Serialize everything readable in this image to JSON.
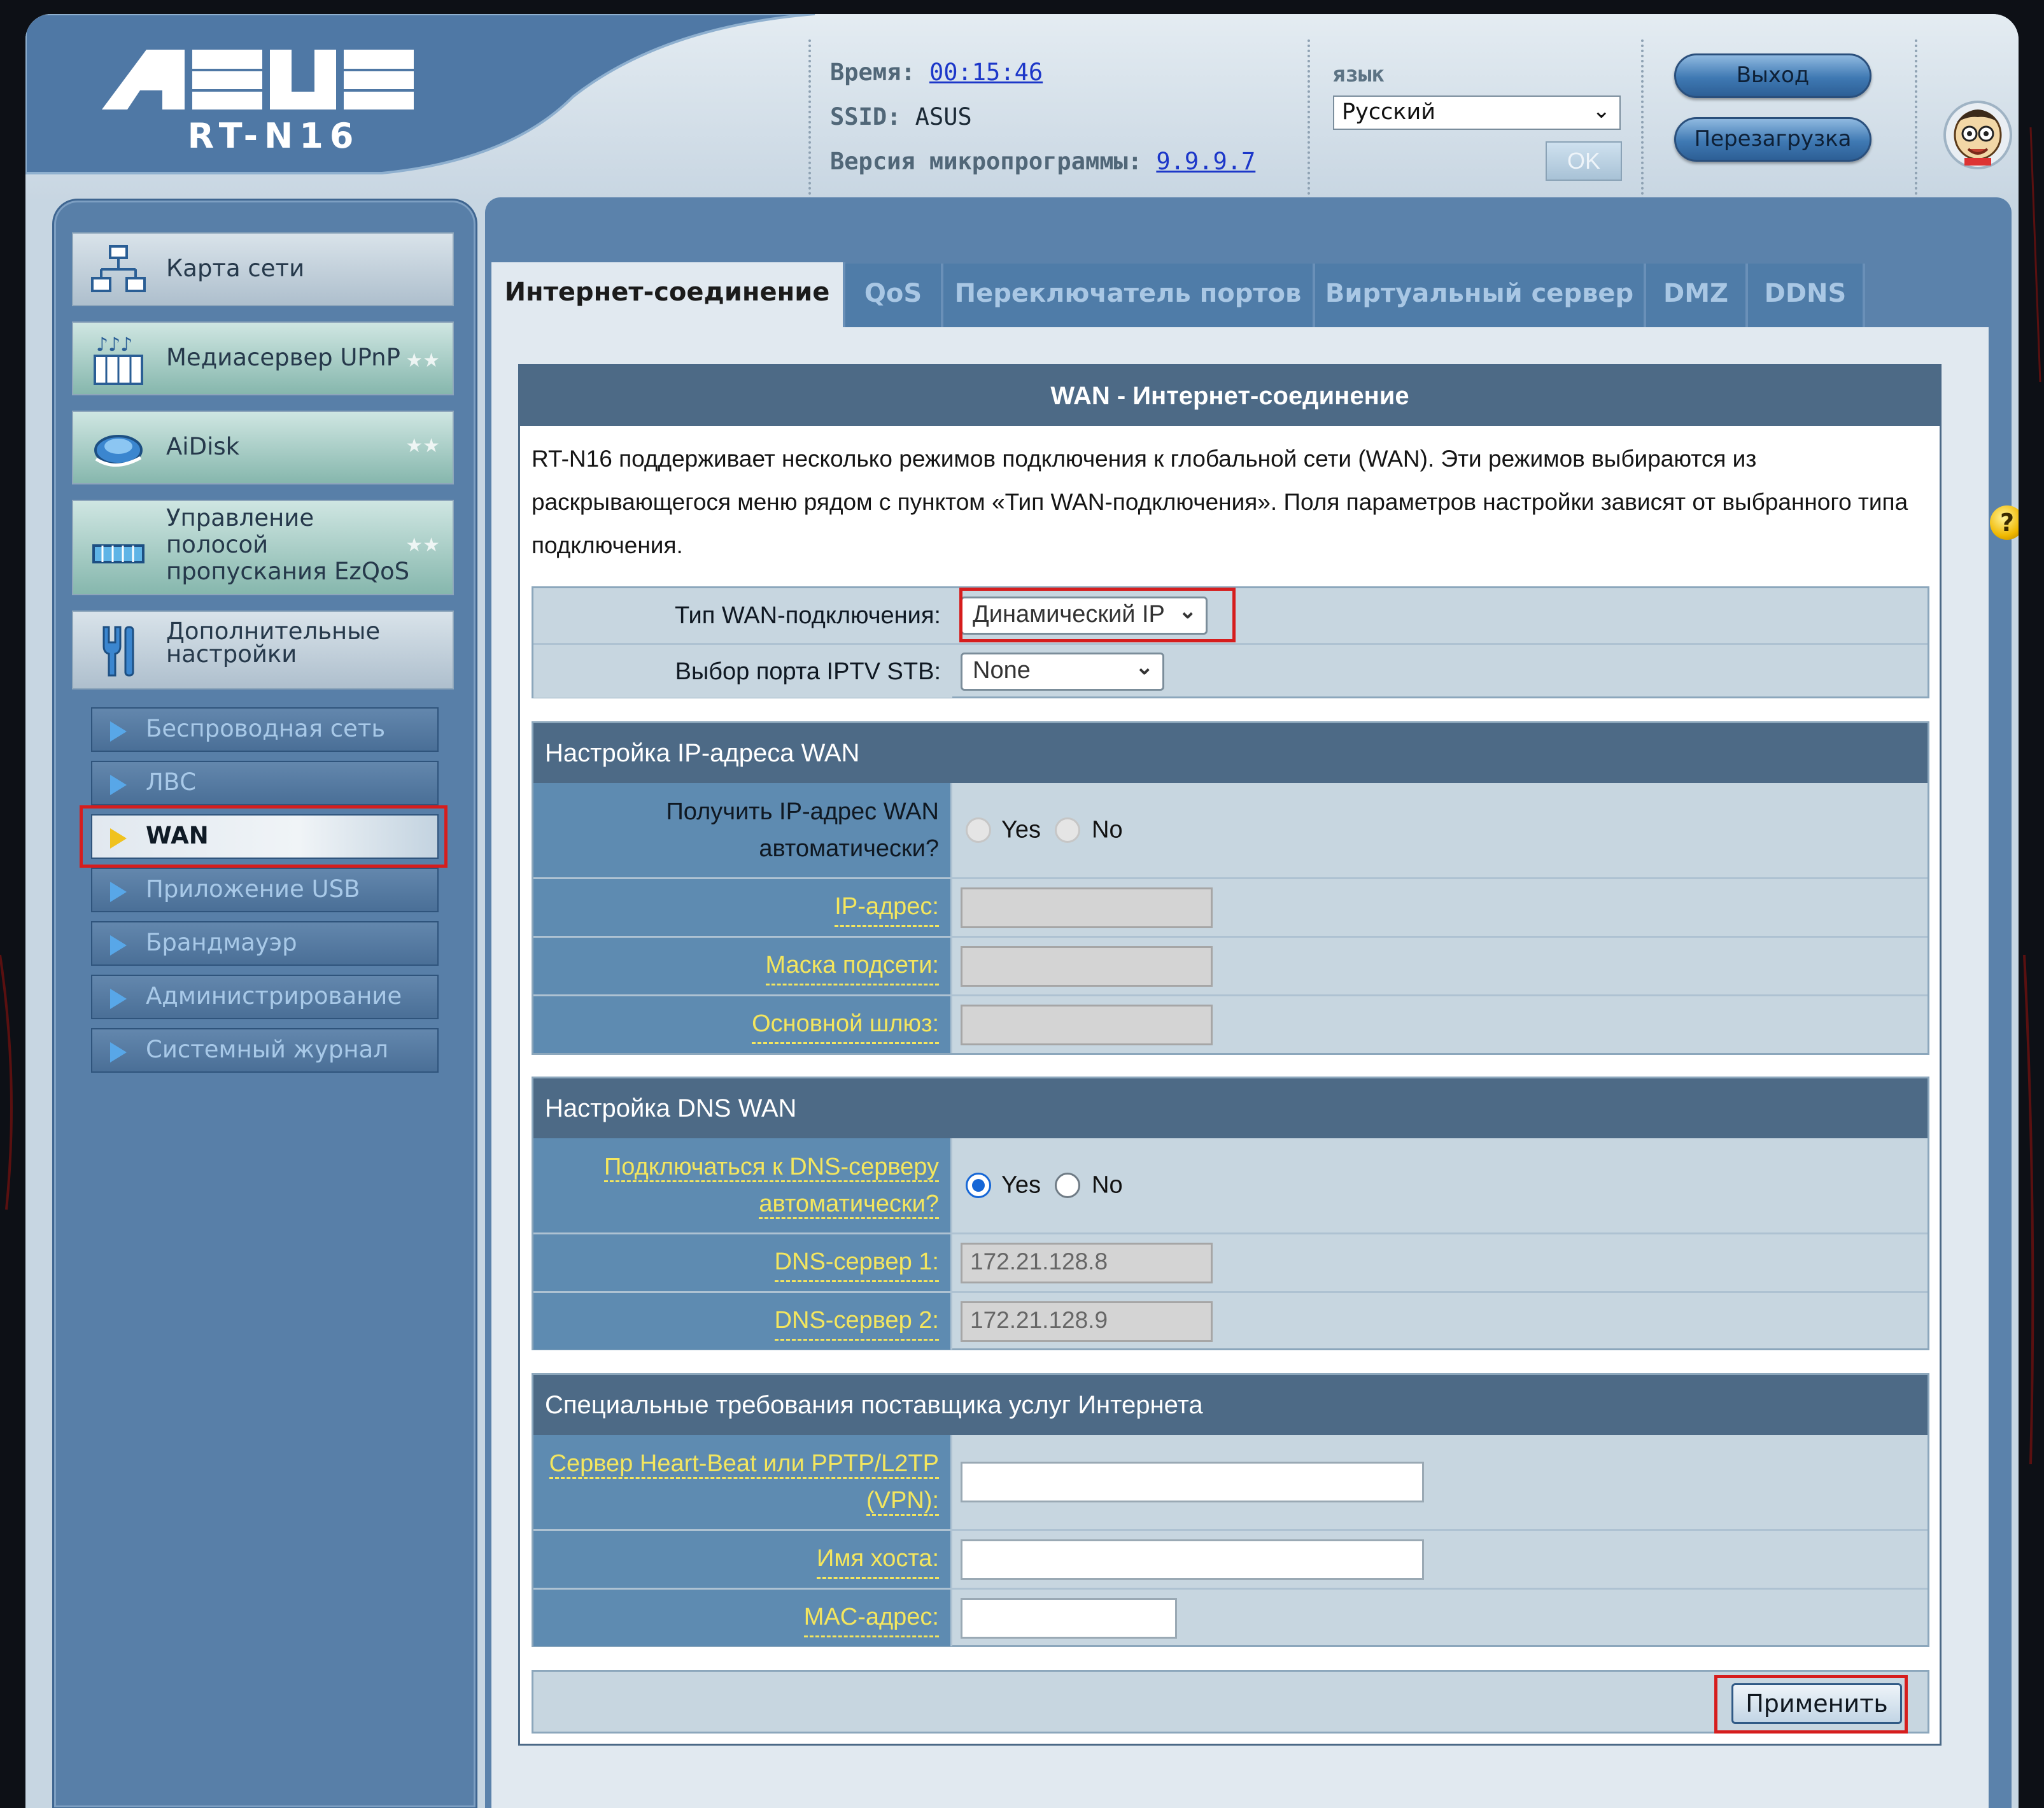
{
  "brand": {
    "logo": "ASUS",
    "model": "RT-N16"
  },
  "header": {
    "time_label": "Время:",
    "time_value": "00:15:46",
    "ssid_label": "SSID:",
    "ssid_value": "ASUS",
    "fw_label": "Версия микропрограммы:",
    "fw_value": "9.9.9.7",
    "lang_label": "язык",
    "lang_selected": "Русский",
    "ok_label": "OK",
    "logout_label": "Выход",
    "reboot_label": "Перезагрузка"
  },
  "sidebar": {
    "main_items": [
      {
        "label": "Карта сети",
        "icon": "network-map-icon"
      },
      {
        "label": "Медиасервер UPnP",
        "icon": "media-server-icon"
      },
      {
        "label": "AiDisk",
        "icon": "aidisk-icon"
      },
      {
        "label_lines": [
          "Управление",
          "полосой",
          "пропускания EzQoS"
        ],
        "icon": "ezqos-icon"
      },
      {
        "label_lines": [
          "Дополнительные",
          "настройки"
        ],
        "icon": "advanced-settings-icon"
      }
    ],
    "sub_items": [
      "Беспроводная сеть",
      "ЛВС",
      "WAN",
      "Приложение USB",
      "Брандмауэр",
      "Администрирование",
      "Системный журнал"
    ],
    "active_sub_item": "WAN"
  },
  "tabs": [
    "Интернет-соединение",
    "QoS",
    "Переключатель портов",
    "Виртуальный сервер",
    "DMZ",
    "DDNS"
  ],
  "active_tab": "Интернет-соединение",
  "panel": {
    "title": "WAN - Интернет-соединение",
    "description": "RT-N16 поддерживает несколько режимов подключения к глобальной сети (WAN). Эти режимов выбираются из раскрывающегося меню рядом с пунктом «Тип WAN-подключения». Поля параметров настройки зависят от выбранного типа подключения.",
    "wan_type_label": "Тип WAN-подключения:",
    "wan_type_value": "Динамический IP",
    "iptv_label": "Выбор порта IPTV STB:",
    "iptv_value": "None",
    "ip_section": {
      "title": "Настройка IP-адреса WAN",
      "auto_ip_label_lines": [
        "Получить IP-адрес WAN",
        "автоматически?"
      ],
      "yes": "Yes",
      "no": "No",
      "ip_label": "IP-адрес:",
      "mask_label": "Маска подсети:",
      "gateway_label": "Основной шлюз:",
      "ip_value": "",
      "mask_value": "",
      "gateway_value": ""
    },
    "dns_section": {
      "title": "Настройка DNS WAN",
      "auto_dns_label_lines": [
        "Подключаться к DNS-серверу",
        "автоматически?"
      ],
      "yes": "Yes",
      "no": "No",
      "auto_dns_selected": "Yes",
      "dns1_label": "DNS-сервер 1:",
      "dns1_value": "172.21.128.8",
      "dns2_label": "DNS-сервер 2:",
      "dns2_value": "172.21.128.9"
    },
    "isp_section": {
      "title": "Специальные требования поставщика услуг Интернета",
      "heartbeat_label_lines": [
        "Сервер Heart-Beat или PPTP/L2TP",
        "(VPN):"
      ],
      "hostname_label": "Имя хоста:",
      "mac_label": "MAC-адрес:",
      "heartbeat_value": "",
      "hostname_value": "",
      "mac_value": ""
    },
    "apply_label": "Применить",
    "help_icon": "?"
  },
  "colors": {
    "highlight": "#d61d1d",
    "header_bar": "#4d6a86",
    "link_yellow": "#f4e65e"
  }
}
